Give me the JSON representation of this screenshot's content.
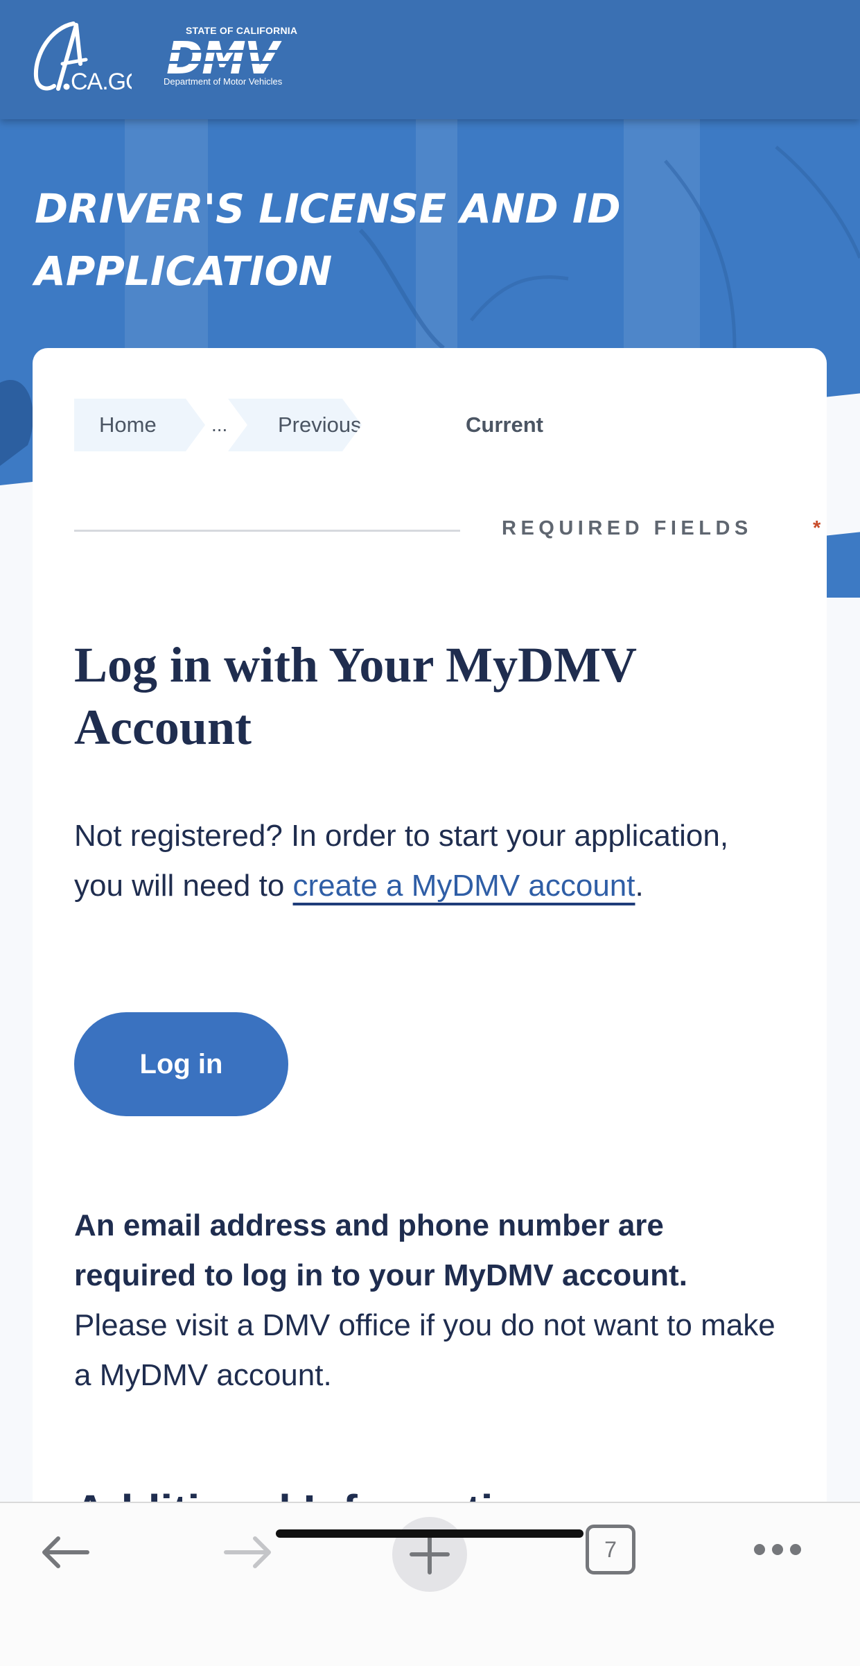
{
  "header": {
    "ca_logo_text": "CA.GOV",
    "dmv_logo_state": "STATE OF CALIFORNIA",
    "dmv_logo_text": "DMV",
    "dmv_logo_dept": "Department of Motor Vehicles"
  },
  "hero": {
    "title": "DRIVER'S LICENSE AND ID APPLICATION"
  },
  "breadcrumb": {
    "home": "Home",
    "ellipsis": "...",
    "previous": "Previous",
    "current": "Current"
  },
  "required_fields": {
    "label": "REQUIRED FIELDS",
    "marker": "*",
    "marker_color": "#c84c2a"
  },
  "login": {
    "title": "Log in with Your MyDMV Account",
    "intro_text": "Not registered? In order to start your application, you will need to ",
    "create_link": "create a MyDMV account",
    "intro_end": ".",
    "button_label": "Log in",
    "note_bold": "An email address and phone number are required to log in to your MyDMV account.",
    "note_rest": " Please visit a DMV office if you do not want to make a MyDMV account.",
    "next_section_partial": "Additional Information"
  },
  "browser": {
    "tab_count": "7",
    "icons": [
      "back-arrow-icon",
      "forward-arrow-icon",
      "plus-icon",
      "tabs-icon",
      "more-icon"
    ]
  },
  "colors": {
    "brand_blue": "#3a70b3",
    "button_blue": "#3a72c0",
    "text_navy": "#1f2d4f",
    "link_blue": "#2f5ea6"
  }
}
